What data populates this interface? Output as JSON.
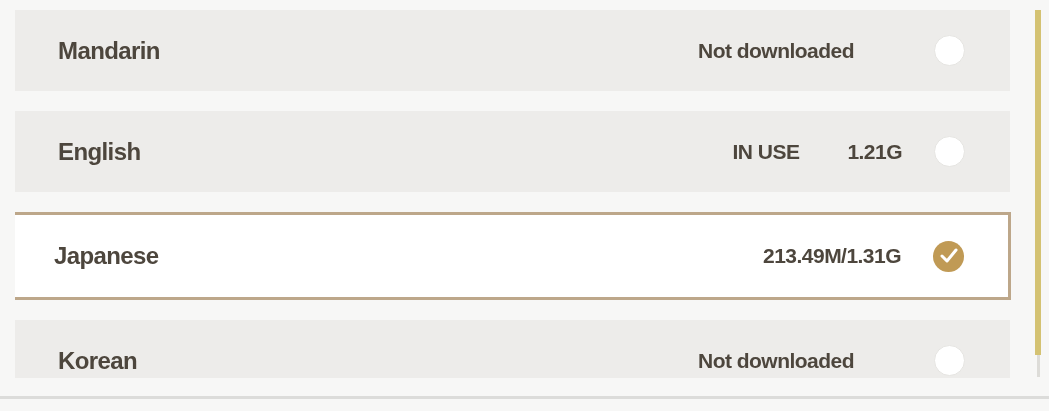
{
  "languages": [
    {
      "name": "Mandarin",
      "info": [
        {
          "kind": "status",
          "text": "Not downloaded"
        }
      ],
      "selected": false
    },
    {
      "name": "English",
      "info": [
        {
          "kind": "status",
          "text": "IN USE"
        },
        {
          "kind": "size",
          "text": "1.21G"
        }
      ],
      "selected": false
    },
    {
      "name": "Japanese",
      "info": [
        {
          "kind": "size",
          "text": "213.49M/1.31G"
        }
      ],
      "selected": true
    },
    {
      "name": "Korean",
      "info": [
        {
          "kind": "status",
          "text": "Not downloaded"
        }
      ],
      "selected": false
    }
  ]
}
